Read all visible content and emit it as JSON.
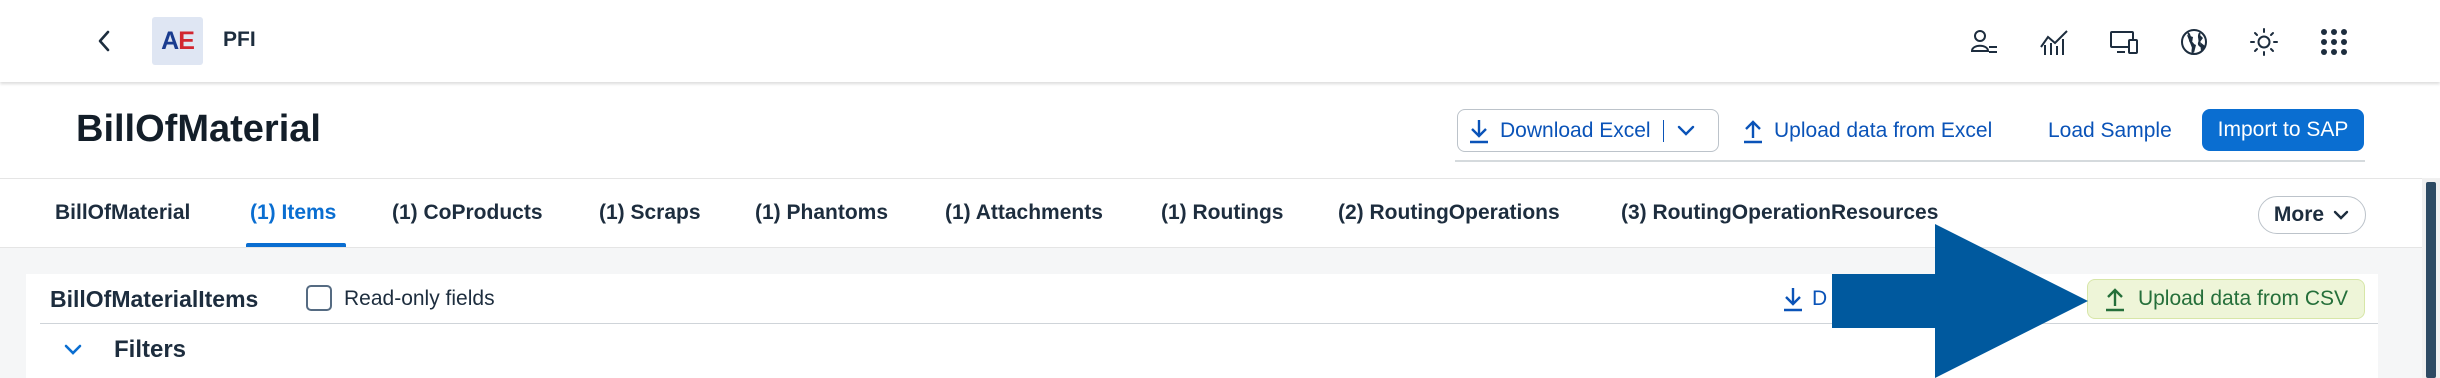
{
  "shell": {
    "logo_a": "A",
    "logo_e": "E",
    "app_title": "PFI",
    "icons": [
      "user-list-icon",
      "analytics-icon",
      "devices-icon",
      "globe-icon",
      "theme-icon",
      "apps-grid-icon"
    ]
  },
  "page": {
    "title": "BillOfMaterial",
    "actions": {
      "download_excel": "Download Excel",
      "upload_excel": "Upload data from Excel",
      "load_sample": "Load Sample",
      "import_sap": "Import to SAP"
    }
  },
  "tabs": [
    {
      "label": "BillOfMaterial"
    },
    {
      "label": "(1) Items"
    },
    {
      "label": "(1) CoProducts"
    },
    {
      "label": "(1) Scraps"
    },
    {
      "label": "(1) Phantoms"
    },
    {
      "label": "(1) Attachments"
    },
    {
      "label": "(1) Routings"
    },
    {
      "label": "(2) RoutingOperations"
    },
    {
      "label": "(3) RoutingOperationResources"
    }
  ],
  "tabs_active_index": 1,
  "more_label": "More",
  "section": {
    "title": "BillOfMaterialItems",
    "readonly_label": "Read-only fields",
    "readonly_checked": false,
    "download_partial": "D",
    "upload_csv": "Upload data from CSV",
    "filters_label": "Filters"
  },
  "colors": {
    "accent": "#0a6ed1",
    "link": "#0a53b8",
    "annotation_arrow": "#00599e",
    "csv_button_bg": "#eef5d8"
  }
}
